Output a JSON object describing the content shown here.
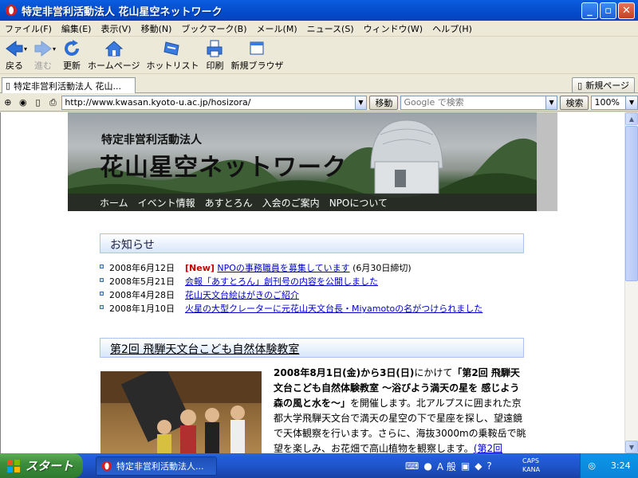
{
  "window": {
    "title": "特定非営利活動法人 花山星空ネットワーク",
    "minimize": "_",
    "maximize": "▫",
    "close": "✕"
  },
  "menu": [
    "ファイル(F)",
    "編集(E)",
    "表示(V)",
    "移動(N)",
    "ブックマーク(B)",
    "メール(M)",
    "ニュース(S)",
    "ウィンドウ(W)",
    "ヘルプ(H)"
  ],
  "toolbar": {
    "back": "戻る",
    "forward": "進む",
    "reload": "更新",
    "home": "ホームページ",
    "hotlist": "ホットリスト",
    "print": "印刷",
    "new_browser": "新規ブラウザ"
  },
  "tabs": {
    "active_label": "特定非営利活動法人 花山...",
    "new_page": "新規ページ"
  },
  "address": {
    "url": "http://www.kwasan.kyoto-u.ac.jp/hosizora/",
    "go": "移動",
    "search_placeholder": "Google で検索",
    "search_button": "検索",
    "zoom": "100%"
  },
  "banner": {
    "org_type": "特定非営利活動法人",
    "org_name": "花山星空ネットワーク"
  },
  "nav": [
    "ホーム",
    "イベント情報",
    "あすとろん",
    "入会のご案内",
    "NPOについて"
  ],
  "news": {
    "heading": "お知らせ",
    "items": [
      {
        "date": "2008年6月12日",
        "new": "[New]",
        "title": "NPOの事務職員を募集しています",
        "note": "(6月30日締切)"
      },
      {
        "date": "2008年5月21日",
        "title": "会報「あすとろん」創刊号の内容を公開しました"
      },
      {
        "date": "2008年4月28日",
        "title": "花山天文台絵はがきのご紹介"
      },
      {
        "date": "2008年1月10日",
        "title": "火星の大型クレーターに元花山天文台長・Miyamotoの名がつけられました"
      }
    ]
  },
  "event": {
    "heading": "第2回 飛騨天文台こども自然体験教室",
    "p1_bold": "2008年8月1日(金)から3日(日)",
    "p1_text": "にかけて",
    "p1_bold2": "「第2回 飛騨天文台こども自然体験教室 ～浴びよう満天の星を 感じよう森の風と水を～」",
    "p1_text2": "を開催します。北アルプスに囲まれた京都大学飛騨天文台で満天の星空の下で星座を探し、望遠鏡で天体観察を行います。さらに、海抜3000mの乗鞍岳で眺望を楽しみ、お花畑で高山植物を観察します。",
    "p1_link": "(第2回"
  },
  "taskbar": {
    "start": "スタート",
    "task": "特定非営利活動法人...",
    "ime": "A 般",
    "caps": "CAPS",
    "kana": "KANA",
    "time": "3:24"
  }
}
